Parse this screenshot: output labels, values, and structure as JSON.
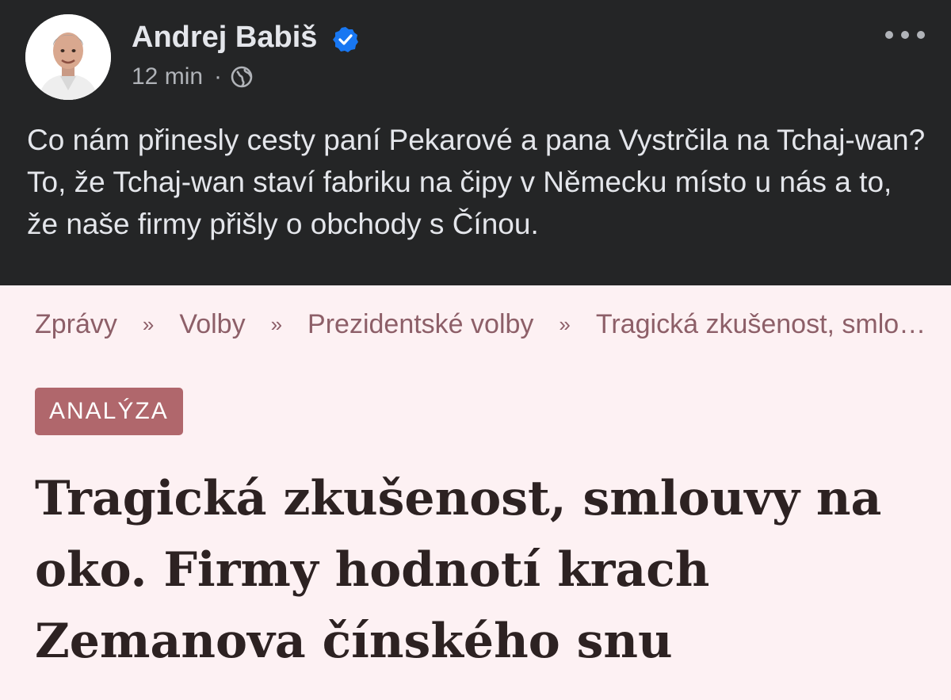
{
  "post": {
    "author": "Andrej Babiš",
    "time": "12 min",
    "separator": "·",
    "text": "Co nám přinesly cesty paní Pekarové a pana Vystrčila na Tchaj-wan? To, že Tchaj-wan staví fabriku na čipy v Německu místo u nás a to, že naše firmy přišly o obchody s Čínou.",
    "verified_icon": "verified-badge-icon",
    "audience_icon": "globe-icon",
    "more_icon": "more-options-icon"
  },
  "article": {
    "breadcrumb": [
      "Zprávy",
      "Volby",
      "Prezidentské volby",
      "Tragická zkušenost, smlouvy na oko. Firmy hodnotí krach Zemanova čínského snu"
    ],
    "breadcrumb_separator": "»",
    "badge": "ANALÝZA",
    "headline": "Tragická zkušenost, smlouvy na oko. Firmy hodnotí krach Zemanova čínského snu"
  },
  "colors": {
    "post_background": "#242526",
    "article_background": "#fdf1f3",
    "badge_background": "#b0676c",
    "breadcrumb_text": "#8d5f68",
    "verified_blue": "#1877f2"
  }
}
